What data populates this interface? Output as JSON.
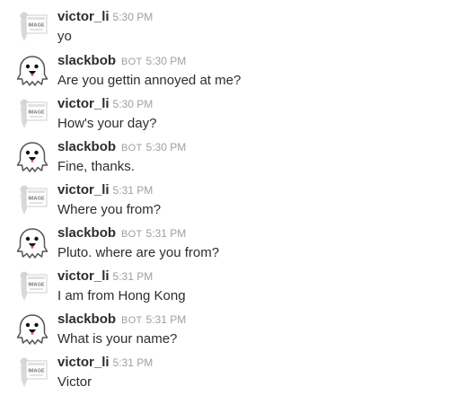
{
  "messages": [
    {
      "user": "victor_li",
      "bot_label": "",
      "time": "5:30 PM",
      "text": "yo",
      "avatar": "no-image-placeholder-icon",
      "avatar_text": [
        "IMAGE"
      ]
    },
    {
      "user": "slackbob",
      "bot_label": "BOT",
      "time": "5:30 PM",
      "text": "Are you gettin annoyed at me?",
      "avatar": "ghost-icon"
    },
    {
      "user": "victor_li",
      "bot_label": "",
      "time": "5:30 PM",
      "text": "How's your day?",
      "avatar": "no-image-placeholder-icon",
      "avatar_text": [
        "IMAGE"
      ]
    },
    {
      "user": "slackbob",
      "bot_label": "BOT",
      "time": "5:30 PM",
      "text": "Fine, thanks.",
      "avatar": "ghost-icon"
    },
    {
      "user": "victor_li",
      "bot_label": "",
      "time": "5:31 PM",
      "text": "Where you from?",
      "avatar": "no-image-placeholder-icon",
      "avatar_text": [
        "IMAGE"
      ]
    },
    {
      "user": "slackbob",
      "bot_label": "BOT",
      "time": "5:31 PM",
      "text": "Pluto. where are you from?",
      "avatar": "ghost-icon"
    },
    {
      "user": "victor_li",
      "bot_label": "",
      "time": "5:31 PM",
      "text": "I am from Hong Kong",
      "avatar": "no-image-placeholder-icon",
      "avatar_text": [
        "IMAGE"
      ]
    },
    {
      "user": "slackbob",
      "bot_label": "BOT",
      "time": "5:31 PM",
      "text": "What is your name?",
      "avatar": "ghost-icon"
    },
    {
      "user": "victor_li",
      "bot_label": "",
      "time": "5:31 PM",
      "text": "Victor",
      "avatar": "no-image-placeholder-icon",
      "avatar_text": [
        "IMAGE"
      ]
    }
  ],
  "colors": {
    "name": "#2c2d30",
    "text": "#2c2d30",
    "muted": "#9e9ea6"
  }
}
